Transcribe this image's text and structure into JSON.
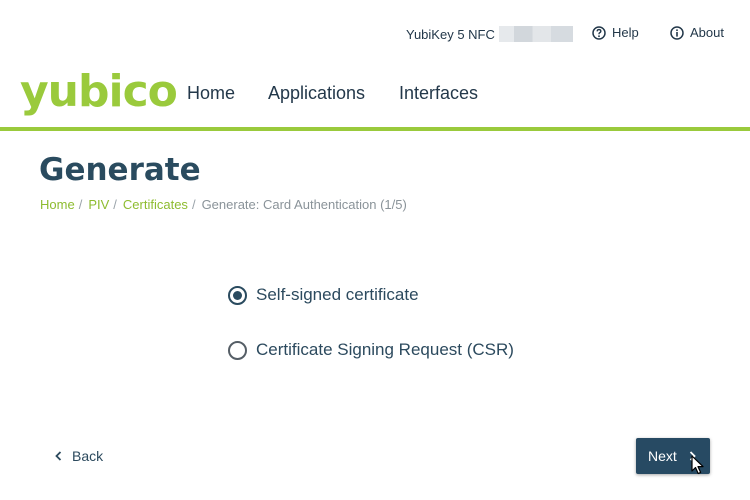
{
  "header": {
    "device_name": "YubiKey 5 NFC",
    "help_label": "Help",
    "about_label": "About"
  },
  "nav": {
    "logo": "yubico",
    "items": [
      {
        "label": "Home"
      },
      {
        "label": "Applications"
      },
      {
        "label": "Interfaces"
      }
    ]
  },
  "page": {
    "title": "Generate",
    "breadcrumb": [
      {
        "label": "Home"
      },
      {
        "label": "PIV"
      },
      {
        "label": "Certificates"
      }
    ],
    "breadcrumb_current": "Generate: Card Authentication (1/5)",
    "separator": "/"
  },
  "options": [
    {
      "label": "Self-signed certificate",
      "selected": true
    },
    {
      "label": "Certificate Signing Request (CSR)",
      "selected": false
    }
  ],
  "footer": {
    "back_label": "Back",
    "next_label": "Next"
  },
  "colors": {
    "brand_green": "#9aca3c",
    "primary_dark": "#274a63",
    "text": "#2c4a5e"
  }
}
